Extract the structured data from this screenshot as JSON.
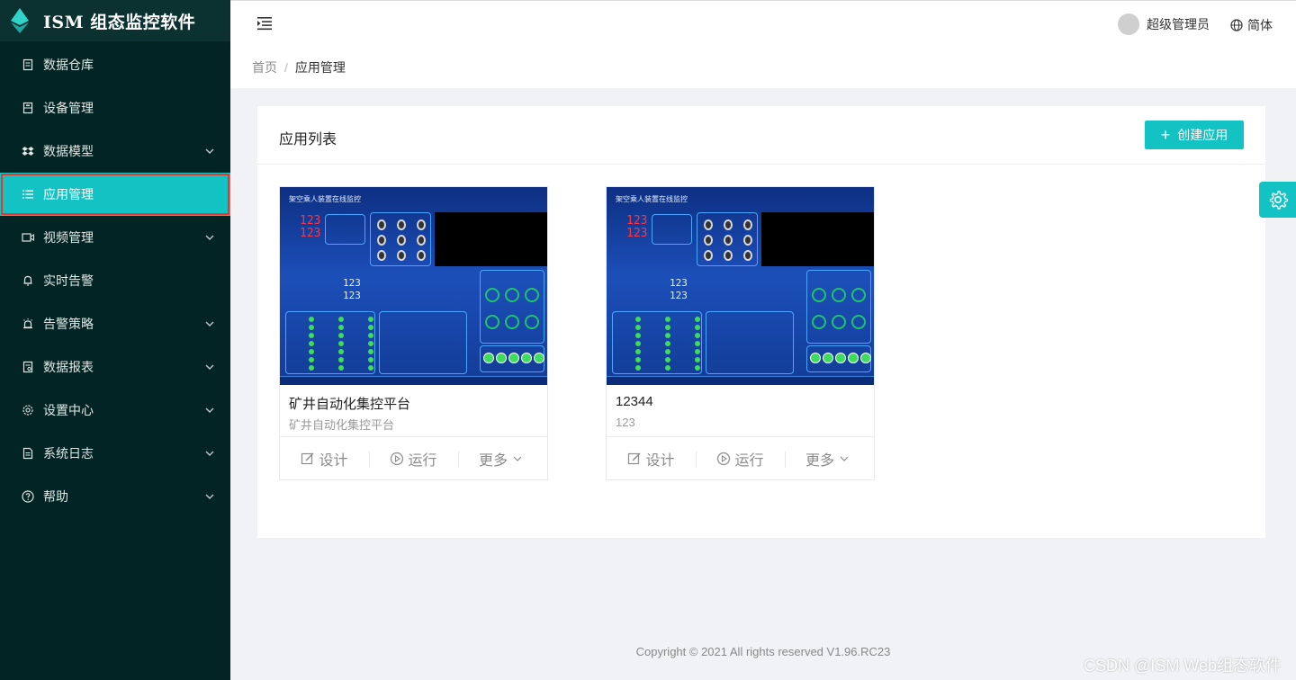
{
  "brand": {
    "title": "ISM 组态监控软件"
  },
  "sidebar": {
    "items": [
      {
        "label": "数据仓库",
        "icon": "database-icon",
        "expandable": false,
        "active": false
      },
      {
        "label": "设备管理",
        "icon": "device-icon",
        "expandable": false,
        "active": false
      },
      {
        "label": "数据模型",
        "icon": "dropbox-icon",
        "expandable": true,
        "active": false
      },
      {
        "label": "应用管理",
        "icon": "list-icon",
        "expandable": false,
        "active": true
      },
      {
        "label": "视频管理",
        "icon": "video-icon",
        "expandable": true,
        "active": false
      },
      {
        "label": "实时告警",
        "icon": "bell-icon",
        "expandable": false,
        "active": false
      },
      {
        "label": "告警策略",
        "icon": "alarm-icon",
        "expandable": true,
        "active": false
      },
      {
        "label": "数据报表",
        "icon": "report-icon",
        "expandable": true,
        "active": false
      },
      {
        "label": "设置中心",
        "icon": "gear-icon",
        "expandable": true,
        "active": false
      },
      {
        "label": "系统日志",
        "icon": "log-icon",
        "expandable": true,
        "active": false
      },
      {
        "label": "帮助",
        "icon": "help-icon",
        "expandable": true,
        "active": false
      }
    ]
  },
  "header": {
    "username": "超级管理员",
    "language": "简体"
  },
  "breadcrumb": {
    "home": "首页",
    "separator": "/",
    "current": "应用管理"
  },
  "panel": {
    "title": "应用列表",
    "create_label": "创建应用"
  },
  "apps": [
    {
      "name": "矿井自动化集控平台",
      "description": "矿井自动化集控平台",
      "thumb_title": "架空乘人装置在线监控",
      "actions": {
        "design": "设计",
        "run": "运行",
        "more": "更多"
      }
    },
    {
      "name": "12344",
      "description": "123",
      "thumb_title": "架空乘人装置在线监控",
      "actions": {
        "design": "设计",
        "run": "运行",
        "more": "更多"
      }
    }
  ],
  "footer": {
    "text": "Copyright © 2021 All rights reserved V1.96.RC23"
  },
  "watermark": "CSDN @ISM Web组态软件",
  "colors": {
    "accent": "#13c2c2",
    "sidebar_bg": "#032424",
    "active_outline": "#e8372c"
  }
}
